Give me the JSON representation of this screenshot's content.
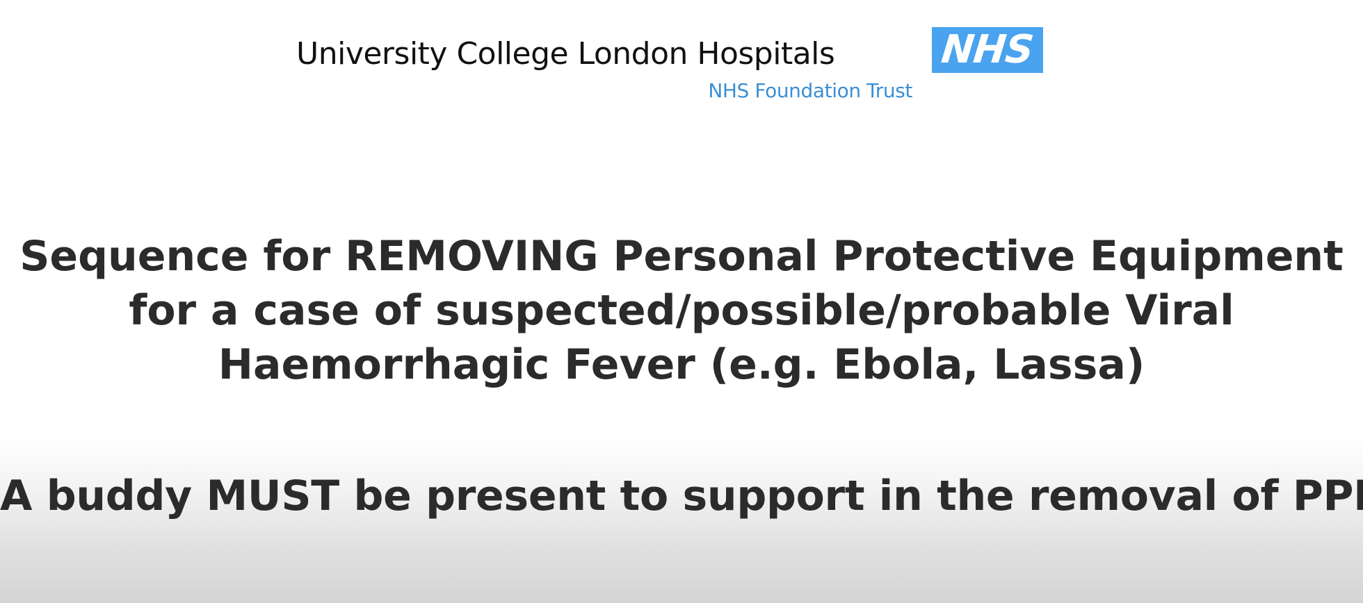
{
  "header": {
    "org_name": "University College London Hospitals",
    "org_sub": "NHS Foundation Trust",
    "logo_text": "NHS",
    "logo_color": "#4aa3ee",
    "sub_color": "#3a8fd6"
  },
  "slide": {
    "title_lines": [
      "Sequence for REMOVING Personal Protective Equipment",
      "for a case of suspected/possible/probable Viral",
      "Haemorrhagic Fever (e.g. Ebola, Lassa)"
    ],
    "notice": "A buddy MUST be present to support in the removal of PPE"
  }
}
